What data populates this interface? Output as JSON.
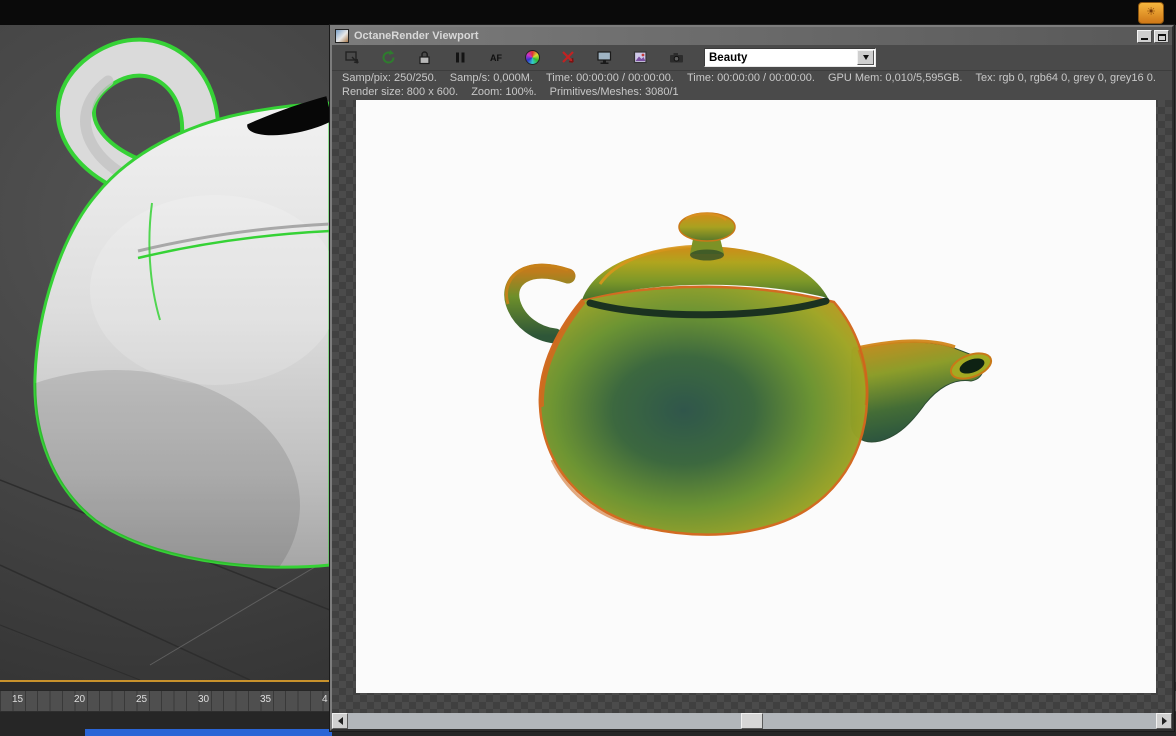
{
  "desktop": {
    "top_bar": {
      "sun_button": "☀"
    },
    "timeline": {
      "labels": [
        "15",
        "20",
        "25",
        "30",
        "35",
        "4"
      ]
    },
    "taskbar_fragment_color": "#2a65d6",
    "viewport": {
      "selected_object": "teapot",
      "selection_outline_color": "#36d236"
    }
  },
  "octane": {
    "title": "OctaneRender Viewport",
    "toolbar": {
      "af_label": "AF",
      "pass_value": "Beauty",
      "icons": [
        "pick-region",
        "restart-render",
        "lock-resolution",
        "pause-render",
        "autofocus",
        "white-balance",
        "reset-view",
        "display",
        "save-image",
        "camera"
      ]
    },
    "stats1": [
      "Samp/pix: 250/250.",
      "Samp/s: 0,000M.",
      "Time: 00:00:00 / 00:00:00.",
      "Time: 00:00:00 / 00:00:00.",
      "GPU Mem: 0,010/5,595GB.",
      "Tex: rgb 0, rgb64 0, grey 0, grey16 0."
    ],
    "stats2": [
      "Render size: 800 x 600.",
      "Zoom: 100%.",
      "Primitives/Meshes: 3080/1"
    ],
    "render_colors": {
      "rim_orange": "#d2691e",
      "body_green": "#6a9230",
      "core_teal": "#2c5348"
    }
  }
}
